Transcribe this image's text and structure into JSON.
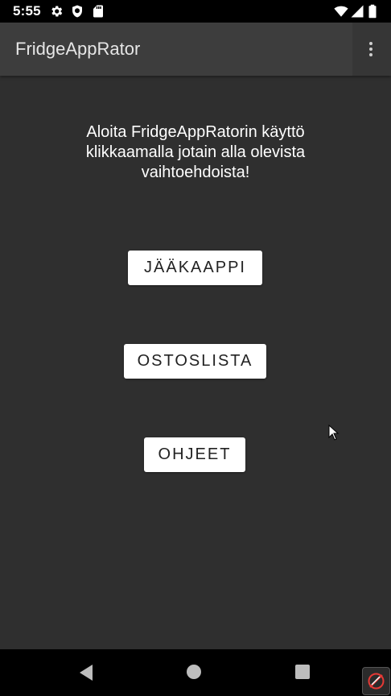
{
  "status_bar": {
    "time": "5:55",
    "icons": [
      "gear-icon",
      "shield-icon",
      "sd-card-icon",
      "wifi-icon",
      "cell-signal-icon",
      "battery-icon"
    ]
  },
  "app_bar": {
    "title": "FridgeAppRator",
    "overflow_icon": "more-vert-icon"
  },
  "main": {
    "intro_text": "Aloita FridgeAppRatorin käyttö klikkaamalla jotain alla olevista vaihtoehdoista!",
    "buttons": {
      "fridge": "JÄÄKAAPPI",
      "shopping_list": "OSTOSLISTA",
      "help": "OHJEET"
    }
  },
  "nav_bar": {
    "icons": [
      "back-icon",
      "home-icon",
      "recents-icon"
    ]
  },
  "colors": {
    "background": "#2f2f2f",
    "app_bar": "#3d3d3d",
    "button_bg": "#ffffff",
    "text": "#ffffff"
  }
}
